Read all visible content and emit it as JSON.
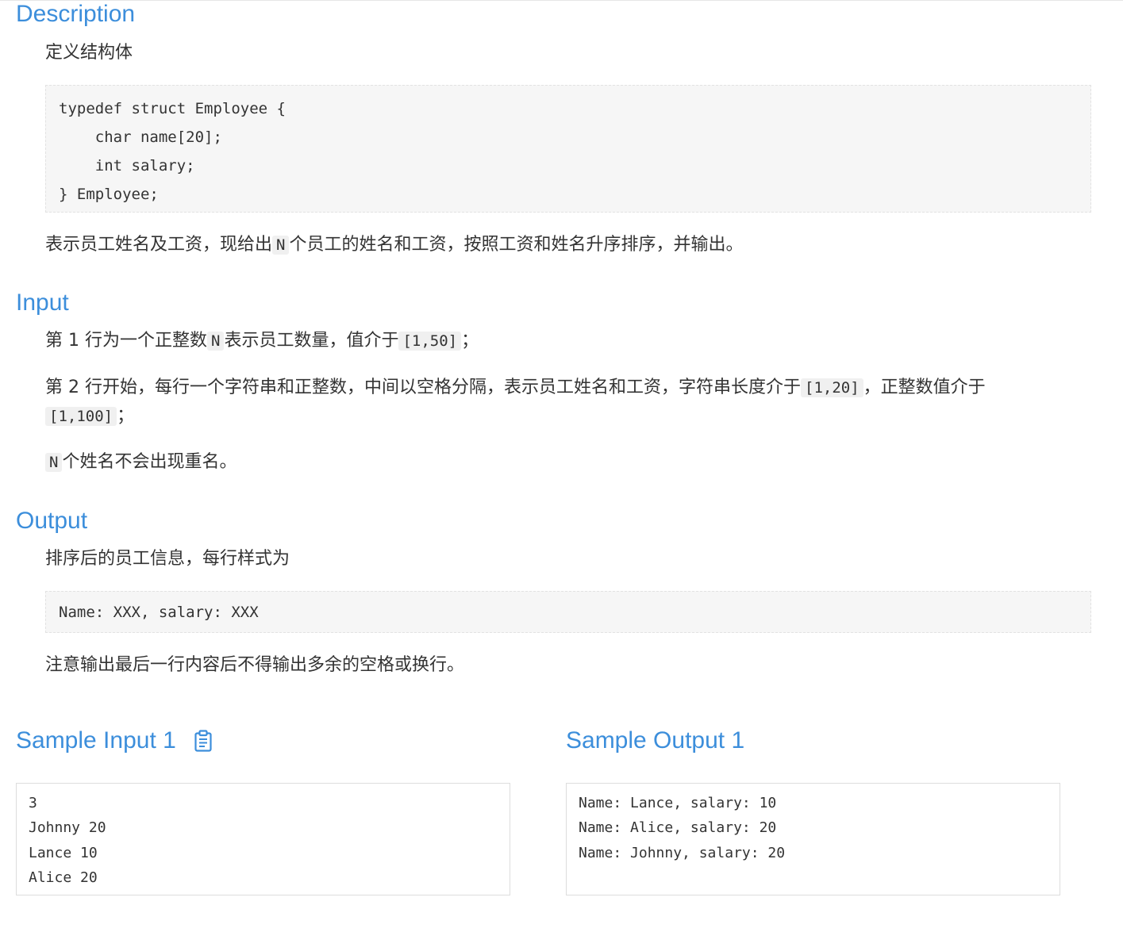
{
  "description": {
    "title": "Description",
    "intro": "定义结构体",
    "code_lines": [
      "typedef struct Employee {",
      "    char name[20];",
      "    int salary;",
      "} Employee;"
    ],
    "text_before": "表示员工姓名及工资，现给出",
    "code_n": "N",
    "text_after": "个员工的姓名和工资，按照工资和姓名升序排序，并输出。"
  },
  "input": {
    "title": "Input",
    "line1_a": "第 1 行为一个正整数",
    "line1_code_n": "N",
    "line1_b": "表示员工数量，值介于",
    "line1_code_range": "[1,50]",
    "line1_c": "；",
    "line2_a": "第 2 行开始，每行一个字符串和正整数，中间以空格分隔，表示员工姓名和工资，字符串长度介于",
    "line2_code_range": "[1,20]",
    "line2_b": "，正整数值介于",
    "line3_code_range": "[1,100]",
    "line3_a": "；",
    "line4_code_n": "N",
    "line4_a": "个姓名不会出现重名。"
  },
  "output": {
    "title": "Output",
    "intro": "排序后的员工信息，每行样式为",
    "code_lines": [
      "Name: XXX, salary: XXX"
    ],
    "note": "注意输出最后一行内容后不得输出多余的空格或换行。"
  },
  "sample_input": {
    "title": "Sample Input 1",
    "copy_icon": "clipboard-icon",
    "lines": [
      "3",
      "Johnny 20",
      "Lance 10",
      "Alice 20"
    ]
  },
  "sample_output": {
    "title": "Sample Output 1",
    "lines": [
      "Name: Lance, salary: 10",
      "Name: Alice, salary: 20",
      "Name: Johnny, salary: 20"
    ]
  },
  "colors": {
    "heading": "#3c8edb",
    "text": "#333333",
    "code_bg": "#f6f6f6",
    "inline_code_bg": "#f0f0f0",
    "border": "#dddddd"
  }
}
